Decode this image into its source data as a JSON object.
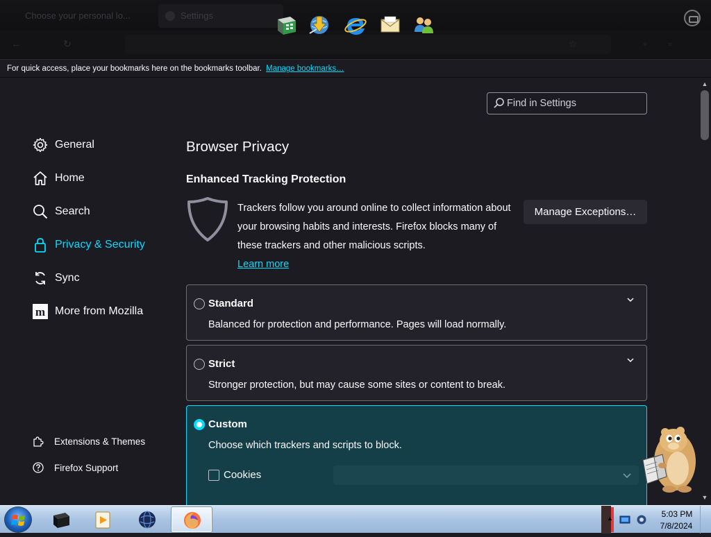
{
  "browser": {
    "tabs": [
      {
        "title": "Choose your personal lo..."
      },
      {
        "title": "Settings"
      }
    ],
    "bookmarks_bar": {
      "message": "For quick access, place your bookmarks here on the bookmarks toolbar.",
      "link": "Manage bookmarks…"
    }
  },
  "quick_launch": [
    {
      "icon": "spreadsheet-icon"
    },
    {
      "icon": "download-globe-icon"
    },
    {
      "icon": "internet-explorer-icon"
    },
    {
      "icon": "mail-envelope-icon"
    },
    {
      "icon": "messenger-users-icon"
    }
  ],
  "search": {
    "placeholder": "Find in Settings"
  },
  "sidebar": {
    "items": [
      {
        "label": "General",
        "icon": "gear-icon"
      },
      {
        "label": "Home",
        "icon": "home-icon"
      },
      {
        "label": "Search",
        "icon": "search-icon"
      },
      {
        "label": "Privacy & Security",
        "icon": "lock-icon",
        "selected": true
      },
      {
        "label": "Sync",
        "icon": "sync-icon"
      },
      {
        "label": "More from Mozilla",
        "icon": "mozilla-icon"
      }
    ],
    "footer": [
      {
        "label": "Extensions & Themes",
        "icon": "puzzle-icon"
      },
      {
        "label": "Firefox Support",
        "icon": "help-icon"
      }
    ]
  },
  "main": {
    "heading": "Browser Privacy",
    "etp": {
      "title": "Enhanced Tracking Protection",
      "description": "Trackers follow you around online to collect information about your browsing habits and interests. Firefox blocks many of these trackers and other malicious scripts.",
      "learn_more": "Learn more",
      "manage_button": "Manage Exceptions…"
    },
    "options": [
      {
        "title": "Standard",
        "description": "Balanced for protection and performance. Pages will load normally.",
        "selected": false
      },
      {
        "title": "Strict",
        "description": "Stronger protection, but may cause some sites or content to break.",
        "selected": false
      },
      {
        "title": "Custom",
        "description": "Choose which trackers and scripts to block.",
        "selected": true
      }
    ],
    "custom": {
      "cookies_label": "Cookies",
      "cookies_checked": false
    }
  },
  "taskbar": {
    "apps": [
      "terminal-icon",
      "media-player-icon",
      "globe-icon",
      "firefox-icon"
    ],
    "active_app": "firefox-icon",
    "time": "5:03 PM",
    "date": "7/8/2024"
  },
  "colors": {
    "accent": "#00ddff",
    "background": "#1c1b22",
    "selected_option": "#143e48"
  }
}
